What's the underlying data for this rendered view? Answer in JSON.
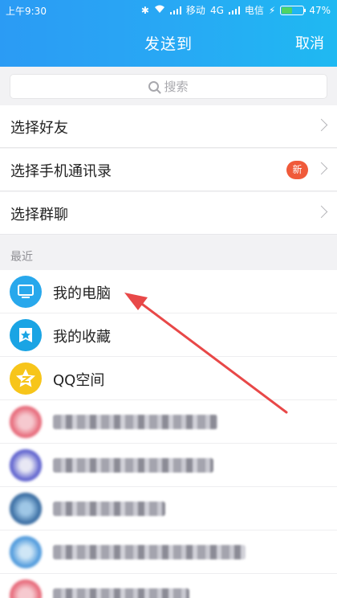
{
  "status_bar": {
    "time": "上午9:30",
    "carrier1": "移动",
    "network": "4G",
    "carrier2": "电信",
    "battery": "47%",
    "battery_level": 0.47
  },
  "header": {
    "title": "发送到",
    "cancel": "取消"
  },
  "search": {
    "placeholder": "搜索"
  },
  "options": [
    {
      "label": "选择好友"
    },
    {
      "label": "选择手机通讯录",
      "badge": "新"
    },
    {
      "label": "选择群聊"
    }
  ],
  "section_label": "最近",
  "recents": [
    {
      "name": "我的电脑",
      "icon": "computer-icon"
    },
    {
      "name": "我的收藏",
      "icon": "favorites-icon"
    },
    {
      "name": "QQ空间",
      "icon": "qzone-icon"
    }
  ],
  "colors": {
    "header_start": "#2b9bf4",
    "header_end": "#1fb9f2",
    "badge": "#f05a3a",
    "arrow": "#e84848"
  }
}
